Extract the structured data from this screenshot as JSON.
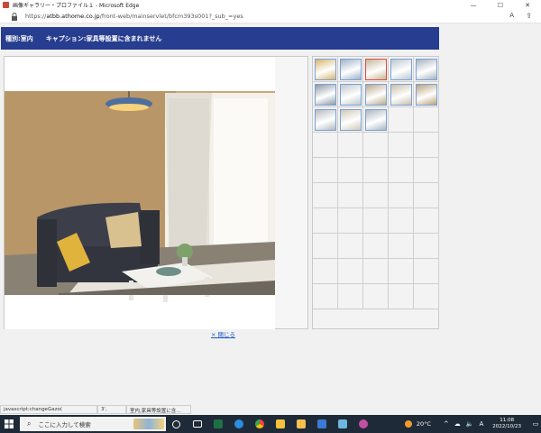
{
  "window": {
    "title": "画像ギャラリー・プロファイル１ - Microsoft Edge",
    "minimize_glyph": "—",
    "maximize_glyph": "☐",
    "close_glyph": "✕"
  },
  "address": {
    "url_prefix": "https://",
    "url_host": "atbb.athome.co.jp",
    "url_path": "/front-web/mainservlet/bfcm393s001?_sub_=yes",
    "read_aloud_label": "A",
    "share_glyph": "⇪"
  },
  "banner": {
    "type_text": "種別:室内",
    "caption_text": "キャプション:家具等設置に含まれません"
  },
  "thumbnails": {
    "filled": 13,
    "total_cells": 50,
    "active_index": 2,
    "colors": [
      "#d8b46a",
      "#9fb1c6",
      "#c7b69a",
      "#bcc7cf",
      "#a7b3bc",
      "#8e9aa5",
      "#c2c7cb",
      "#b8a88a",
      "#c9bfa8",
      "#b9a27a",
      "#b5bbbf",
      "#d0c8b6",
      "#a9b6c2"
    ]
  },
  "close_link": "× 閉じる",
  "statusbar": {
    "segments": [
      "javascript:changeGazo(",
      "3',",
      "室内,家具等設置に含..."
    ]
  },
  "taskbar": {
    "search_placeholder": "ここに入力して検索",
    "temperature": "20°C",
    "time": "11:08",
    "date": "2022/10/23",
    "ime_label": "A",
    "tray_up_glyph": "^"
  }
}
